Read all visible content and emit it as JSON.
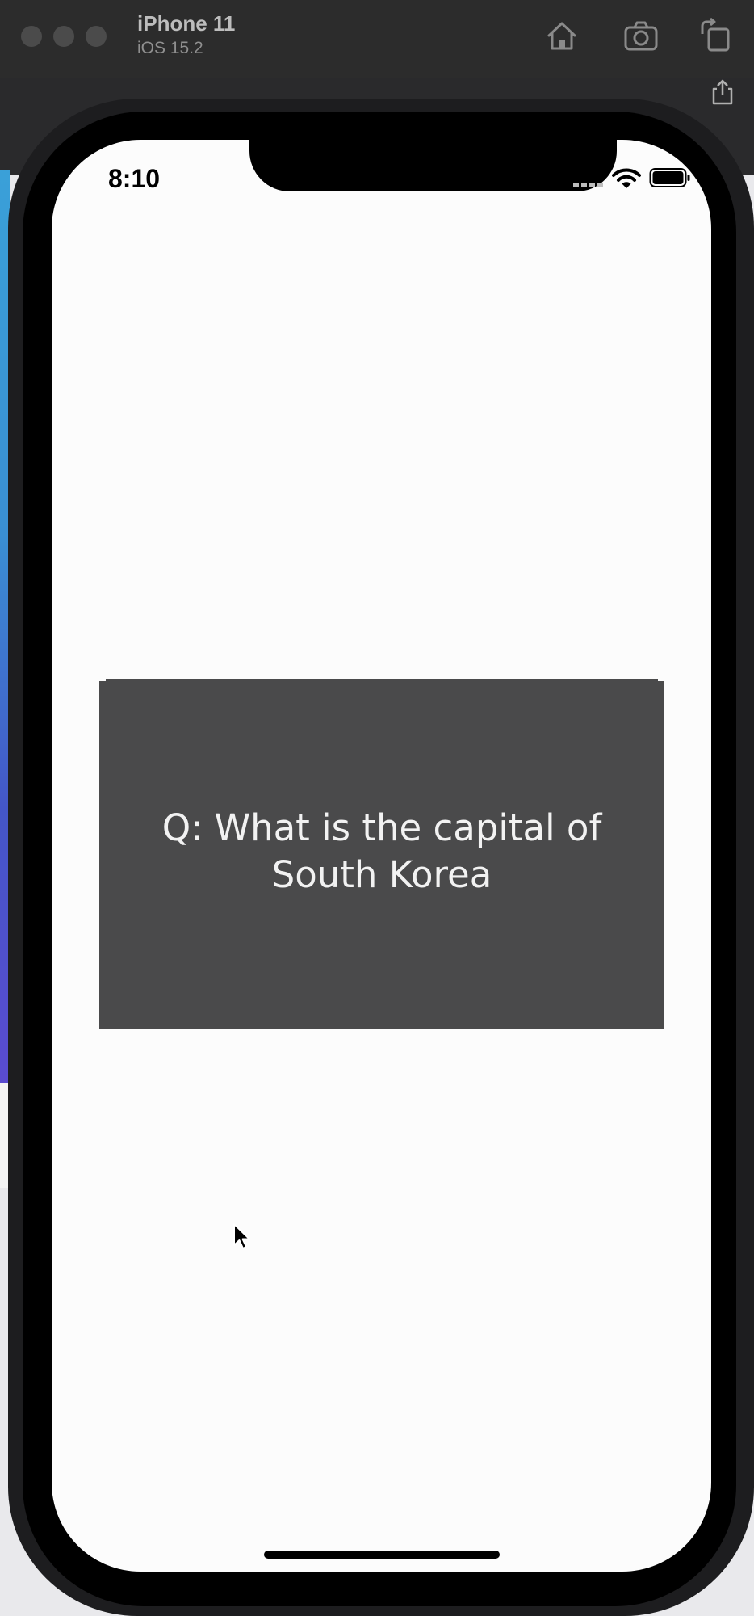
{
  "simulator": {
    "device_name": "iPhone 11",
    "os_version": "iOS 15.2",
    "toolbar": {
      "home_icon": "home-icon",
      "screenshot_icon": "camera-icon",
      "rotate_icon": "rotate-icon",
      "share_icon": "share-icon"
    }
  },
  "status_bar": {
    "time": "8:10",
    "icons": [
      "cellular-signal-icon",
      "wifi-icon",
      "battery-icon"
    ]
  },
  "flashcard": {
    "question": "Q: What is the capital of South Korea",
    "background_color": "#4a4a4b",
    "text_color": "#f2f2f2"
  },
  "colors": {
    "screen_background": "#fcfcfc",
    "titlebar": "#2c2c2c"
  }
}
